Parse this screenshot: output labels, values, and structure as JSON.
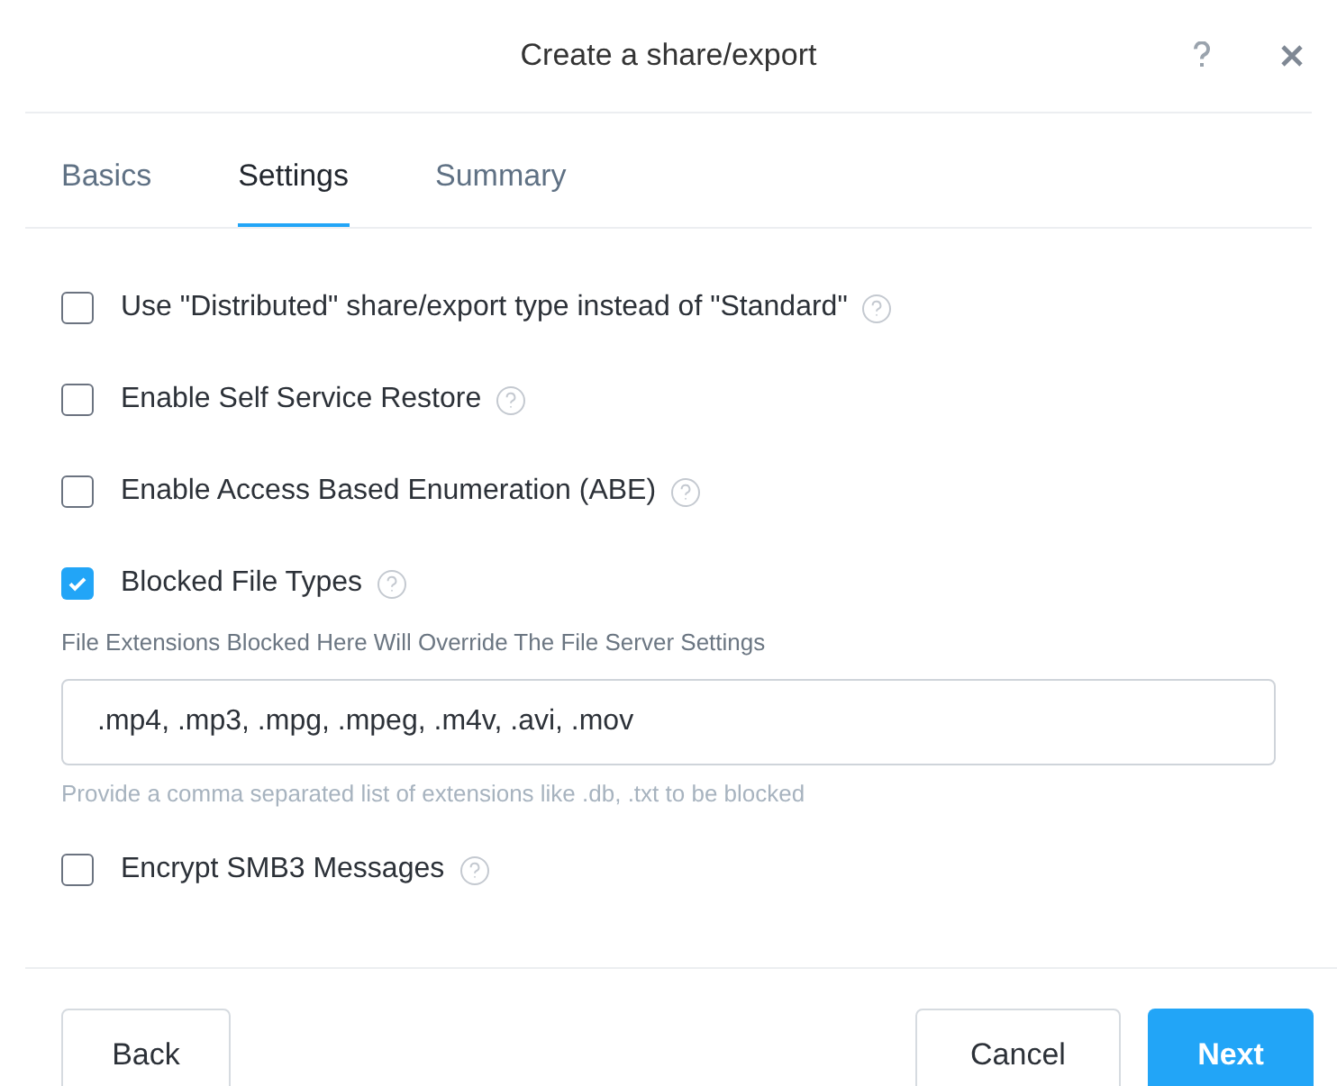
{
  "dialog": {
    "title": "Create a share/export"
  },
  "tabs": [
    {
      "label": "Basics",
      "selected": false
    },
    {
      "label": "Settings",
      "selected": true
    },
    {
      "label": "Summary",
      "selected": false
    }
  ],
  "options": [
    {
      "label": "Use \"Distributed\" share/export type instead of \"Standard\"",
      "checked": false
    },
    {
      "label": "Enable Self Service Restore",
      "checked": false
    },
    {
      "label": "Enable Access Based Enumeration (ABE)",
      "checked": false
    },
    {
      "label": "Blocked File Types",
      "checked": true,
      "details": {
        "label": "File Extensions Blocked Here Will Override The File Server Settings",
        "value": ".mp4, .mp3, .mpg, .mpeg, .m4v, .avi, .mov",
        "hint": "Provide a comma separated list of extensions like .db, .txt to be blocked"
      }
    },
    {
      "label": "Encrypt SMB3 Messages",
      "checked": false
    }
  ],
  "footer": {
    "back": "Back",
    "cancel": "Cancel",
    "next": "Next"
  }
}
